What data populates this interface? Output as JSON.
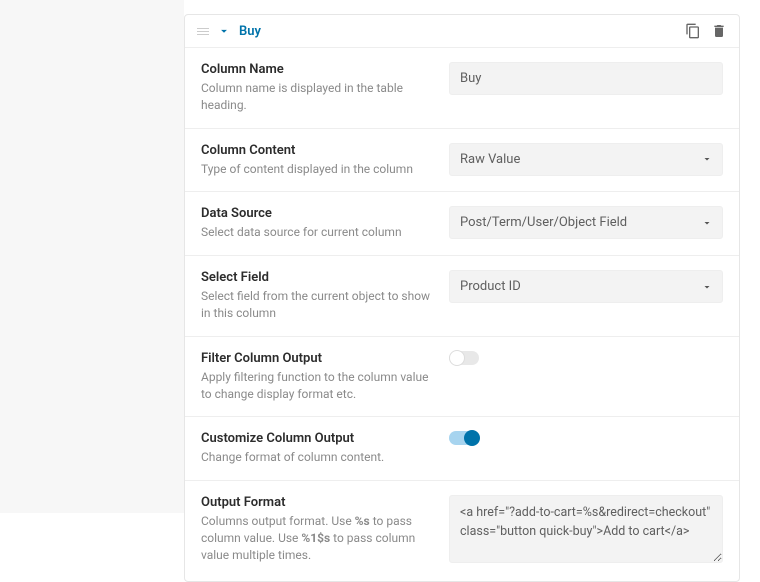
{
  "header": {
    "title": "Buy"
  },
  "rows": {
    "column_name": {
      "label": "Column Name",
      "desc": "Column name is displayed in the table heading.",
      "value": "Buy"
    },
    "column_content": {
      "label": "Column Content",
      "desc": "Type of content displayed in the column",
      "value": "Raw Value"
    },
    "data_source": {
      "label": "Data Source",
      "desc": "Select data source for current column",
      "value": "Post/Term/User/Object Field"
    },
    "select_field": {
      "label": "Select Field",
      "desc": "Select field from the current object to show in this column",
      "value": "Product ID"
    },
    "filter_output": {
      "label": "Filter Column Output",
      "desc": "Apply filtering function to the column value to change display format etc."
    },
    "customize_output": {
      "label": "Customize Column Output",
      "desc": "Change format of column content."
    },
    "output_format": {
      "label": "Output Format",
      "desc_full": "Columns output format. Use %s to pass column value. Use %1$s to pass column value multiple times.",
      "value": "<a href=\"?add-to-cart=%s&redirect=checkout\" class=\"button quick-buy\">Add to cart</a>"
    }
  }
}
